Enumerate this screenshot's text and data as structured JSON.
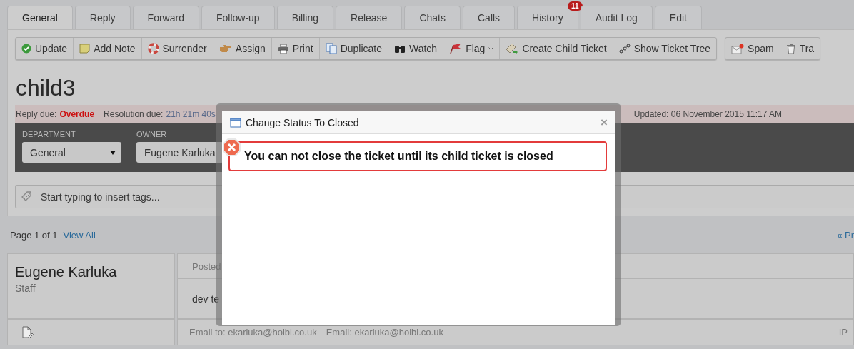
{
  "tabs": [
    {
      "label": "General",
      "selected": true
    },
    {
      "label": "Reply",
      "selected": false
    },
    {
      "label": "Forward",
      "selected": false
    },
    {
      "label": "Follow-up",
      "selected": false
    },
    {
      "label": "Billing",
      "selected": false
    },
    {
      "label": "Release",
      "selected": false
    },
    {
      "label": "Chats",
      "selected": false
    },
    {
      "label": "Calls",
      "selected": false
    },
    {
      "label": "History",
      "selected": false,
      "badge": "11"
    },
    {
      "label": "Audit Log",
      "selected": false
    },
    {
      "label": "Edit",
      "selected": false
    }
  ],
  "toolbar": {
    "main": [
      {
        "label": "Update"
      },
      {
        "label": "Add Note"
      },
      {
        "label": "Surrender"
      },
      {
        "label": "Assign"
      },
      {
        "label": "Print"
      },
      {
        "label": "Duplicate"
      },
      {
        "label": "Watch"
      },
      {
        "label": "Flag",
        "dropdown": true
      },
      {
        "label": "Create Child Ticket"
      },
      {
        "label": "Show Ticket Tree"
      }
    ],
    "extra": [
      {
        "label": "Spam"
      },
      {
        "label": "Tra"
      }
    ]
  },
  "ticket": {
    "title": "child3",
    "due": {
      "reply_label": "Reply due:",
      "reply_value": "Overdue",
      "resolution_label": "Resolution due:",
      "resolution_value": "21h 21m 40s",
      "updated": "Updated: 06 November 2015 11:17 AM"
    },
    "fields": [
      {
        "label": "DEPARTMENT",
        "value": "General"
      },
      {
        "label": "OWNER",
        "value": "Eugene Karluka"
      }
    ],
    "tags": {
      "placeholder": "Start typing to insert tags..."
    }
  },
  "pagination": {
    "page": "Page 1 of 1",
    "view_all": "View All",
    "prev": "« Pr"
  },
  "post": {
    "author": "Eugene Karluka",
    "role": "Staff",
    "header": "Posted",
    "body": "dev te",
    "email_to": "Email to: ekarluka@holbi.co.uk",
    "email": "Email: ekarluka@holbi.co.uk",
    "ip": "IP"
  },
  "dialog": {
    "title": "Change Status To Closed",
    "close": "×",
    "error": "You can not close the ticket until its child ticket is closed"
  }
}
